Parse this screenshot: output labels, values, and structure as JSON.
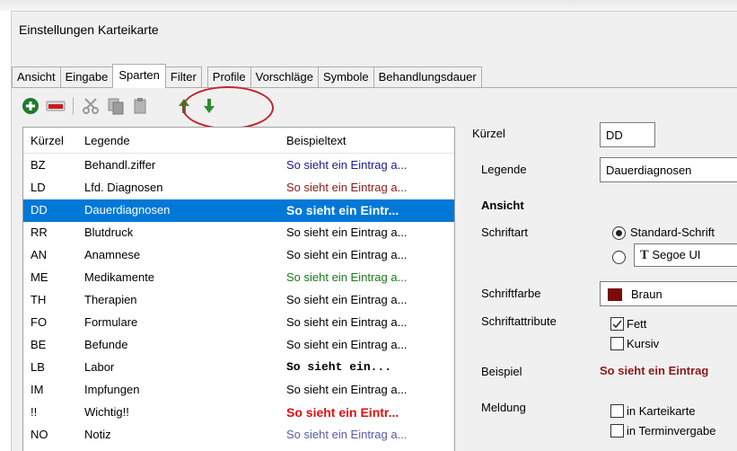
{
  "window": {
    "title": "Einstellungen Karteikarte"
  },
  "tabs": [
    {
      "label": "Ansicht"
    },
    {
      "label": "Eingabe"
    },
    {
      "label": "Sparten",
      "active": true
    },
    {
      "label": "Filter"
    },
    {
      "label": "Profile"
    },
    {
      "label": "Vorschläge"
    },
    {
      "label": "Symbole"
    },
    {
      "label": "Behandlungsdauer"
    }
  ],
  "toolbar": {
    "icons": [
      "add-icon",
      "remove-icon",
      "cut-icon",
      "copy-icon",
      "paste-icon",
      "move-up-icon",
      "move-down-icon"
    ],
    "highlight_color": "#c0262d"
  },
  "list": {
    "headers": [
      "Kürzel",
      "Legende",
      "Beispieltext"
    ],
    "rows": [
      {
        "code": "BZ",
        "legend": "Behandl.ziffer",
        "sample": "So sieht ein Eintrag a...",
        "color": "#1a1a8c",
        "style": "normal"
      },
      {
        "code": "LD",
        "legend": "Lfd. Diagnosen",
        "sample": "So sieht ein Eintrag a...",
        "color": "#8b1a1a",
        "style": "normal"
      },
      {
        "code": "DD",
        "legend": "Dauerdiagnosen",
        "sample": "So sieht ein Eintr...",
        "color": "#ffffff",
        "style": "bold",
        "selected": true
      },
      {
        "code": "RR",
        "legend": "Blutdruck",
        "sample": "So sieht ein Eintrag a...",
        "color": "#000000",
        "style": "normal"
      },
      {
        "code": "AN",
        "legend": "Anamnese",
        "sample": "So sieht ein Eintrag a...",
        "color": "#000000",
        "style": "normal"
      },
      {
        "code": "ME",
        "legend": "Medikamente",
        "sample": "So sieht ein Eintrag a...",
        "color": "#1a7a1a",
        "style": "normal"
      },
      {
        "code": "TH",
        "legend": "Therapien",
        "sample": "So sieht ein Eintrag a...",
        "color": "#000000",
        "style": "normal"
      },
      {
        "code": "FO",
        "legend": "Formulare",
        "sample": "So sieht ein Eintrag a...",
        "color": "#000000",
        "style": "normal"
      },
      {
        "code": "BE",
        "legend": "Befunde",
        "sample": "So sieht ein Eintrag a...",
        "color": "#000000",
        "style": "normal"
      },
      {
        "code": "LB",
        "legend": "Labor",
        "sample": "So sieht ein...",
        "color": "#000000",
        "style": "mono"
      },
      {
        "code": "IM",
        "legend": "Impfungen",
        "sample": "So sieht ein Eintrag a...",
        "color": "#000000",
        "style": "normal"
      },
      {
        "code": "!!",
        "legend": "Wichtig!!",
        "sample": "So sieht ein Eintr...",
        "color": "#e01010",
        "style": "bold"
      },
      {
        "code": "NO",
        "legend": "Notiz",
        "sample": "So sieht ein Eintrag a...",
        "color": "#5a5aa8",
        "style": "normal"
      }
    ]
  },
  "details": {
    "kuerzel_label": "Kürzel",
    "kuerzel_value": "DD",
    "legende_label": "Legende",
    "legende_value": "Dauerdiagnosen",
    "ansicht_heading": "Ansicht",
    "schriftart_label": "Schriftart",
    "font_option_standard": "Standard-Schrift",
    "font_option_custom": "Segoe UI",
    "schriftfarbe_label": "Schriftfarbe",
    "color_value": "Braun",
    "color_swatch": "#7b0a0a",
    "schriftattribute_label": "Schriftattribute",
    "fett_label": "Fett",
    "fett_checked": true,
    "kursiv_label": "Kursiv",
    "kursiv_checked": false,
    "beispiel_label": "Beispiel",
    "beispiel_value": "So sieht ein Eintrag",
    "beispiel_color": "#8b1a1a",
    "meldung_label": "Meldung",
    "in_karteikarte_label": "in Karteikarte",
    "in_terminvergabe_label": "in Terminvergabe"
  }
}
